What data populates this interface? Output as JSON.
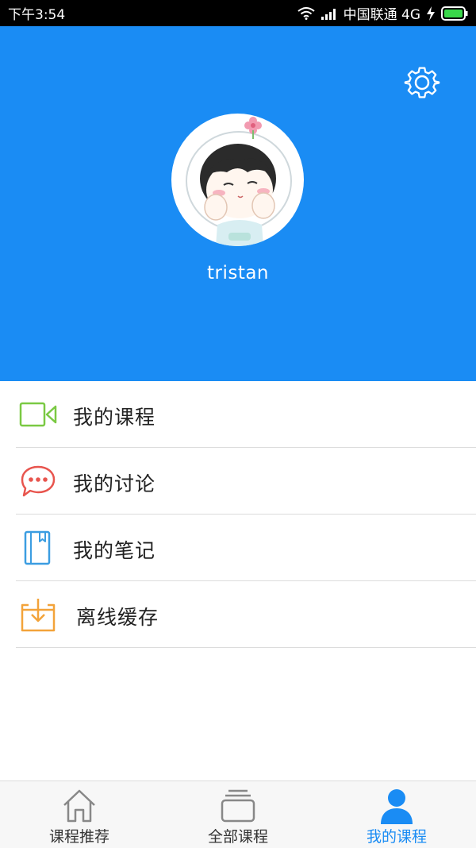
{
  "status_bar": {
    "time": "下午3:54",
    "carrier": "中国联通 4G"
  },
  "profile": {
    "username": "tristan"
  },
  "menu": [
    {
      "label": "我的课程",
      "icon": "video-camera-icon",
      "color": "#7ac943"
    },
    {
      "label": "我的讨论",
      "icon": "chat-bubble-icon",
      "color": "#e8554e"
    },
    {
      "label": "我的笔记",
      "icon": "notebook-icon",
      "color": "#3b9de1"
    },
    {
      "label": "离线缓存",
      "icon": "download-box-icon",
      "color": "#f3a33a"
    }
  ],
  "bottom_nav": [
    {
      "label": "课程推荐",
      "icon": "home-icon",
      "active": false
    },
    {
      "label": "全部课程",
      "icon": "stack-icon",
      "active": false
    },
    {
      "label": "我的课程",
      "icon": "user-icon",
      "active": true
    }
  ],
  "colors": {
    "primary": "#1a8cf4",
    "video": "#7ac943",
    "discussion": "#e8554e",
    "notes": "#3b9de1",
    "offline": "#f3a33a"
  }
}
